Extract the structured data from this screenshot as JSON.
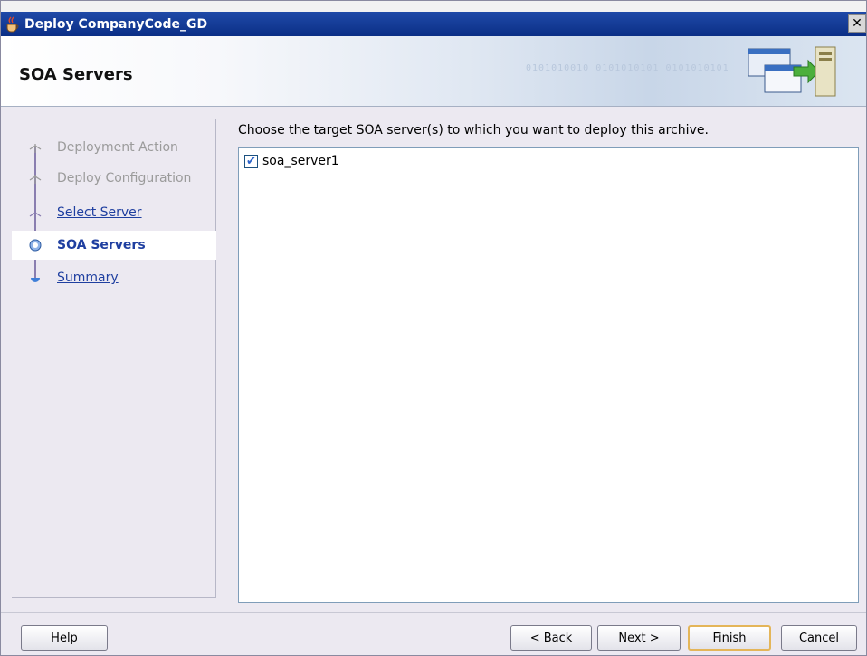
{
  "window": {
    "title": "Deploy CompanyCode_GD",
    "close_label": "✕"
  },
  "banner": {
    "title": "SOA Servers",
    "art_text": "0101010010  0101010101 0101010101"
  },
  "nav": {
    "items": [
      {
        "label": "Deployment Action",
        "state": "disabled"
      },
      {
        "label": "Deploy Configuration",
        "state": "disabled"
      },
      {
        "label": "Select Server",
        "state": "link"
      },
      {
        "label": "SOA Servers",
        "state": "active"
      },
      {
        "label": "Summary",
        "state": "link"
      }
    ]
  },
  "main": {
    "prompt": "Choose the target SOA server(s) to which you want to deploy this archive.",
    "servers": [
      {
        "label": "soa_server1",
        "checked": true,
        "check_glyph": "✔"
      }
    ]
  },
  "footer": {
    "help": "Help",
    "back": "< Back",
    "next": "Next >",
    "finish": "Finish",
    "cancel": "Cancel"
  },
  "colors": {
    "titlebar": "#0b2f86",
    "link": "#1f3fa0",
    "finish_border": "#e4b559"
  },
  "icons": {
    "app": "java-cup-icon",
    "banner": "deploy-windows-icon",
    "close": "close-icon"
  }
}
